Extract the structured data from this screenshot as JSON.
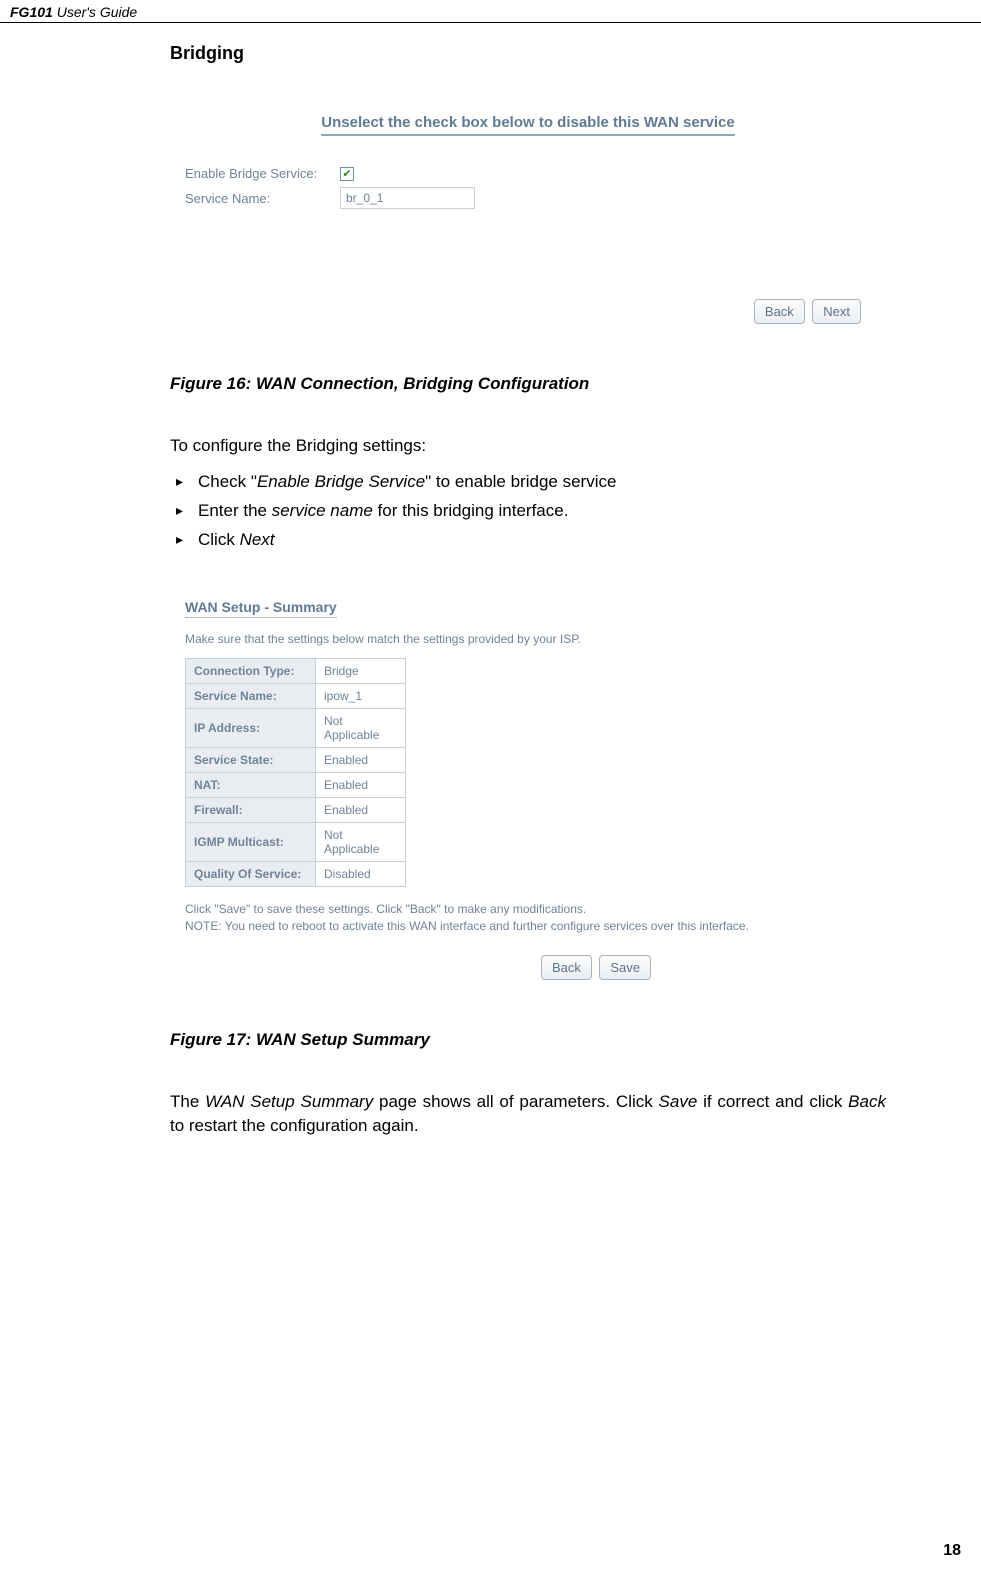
{
  "header": {
    "product": "FG101",
    "suffix": " User's Guide"
  },
  "section": {
    "heading": "Bridging"
  },
  "fig1": {
    "title": "Unselect the check box below to disable this WAN service",
    "enable_label": "Enable Bridge Service:",
    "enable_checked": "✔",
    "service_name_label": "Service Name:",
    "service_name_value": "br_0_1",
    "back_btn": "Back",
    "next_btn": "Next"
  },
  "caption1": "Figure 16: WAN Connection, Bridging Configuration",
  "intro": "To configure the Bridging settings:",
  "bullets": {
    "b1_pre": "Check \"",
    "b1_em": "Enable Bridge Service",
    "b1_post": "\" to enable bridge service",
    "b2_pre": "Enter the ",
    "b2_em": "service name",
    "b2_post": " for this bridging interface.",
    "b3_pre": "Click ",
    "b3_em": "Next"
  },
  "fig2": {
    "title": "WAN Setup - Summary",
    "desc": "Make sure that the settings below match the settings provided by your ISP.",
    "rows": [
      {
        "label": "Connection Type:",
        "val": "Bridge"
      },
      {
        "label": "Service Name:",
        "val": "ipow_1"
      },
      {
        "label": "IP Address:",
        "val": "Not Applicable"
      },
      {
        "label": "Service State:",
        "val": "Enabled"
      },
      {
        "label": "NAT:",
        "val": "Enabled"
      },
      {
        "label": "Firewall:",
        "val": "Enabled"
      },
      {
        "label": "IGMP Multicast:",
        "val": "Not Applicable"
      },
      {
        "label": "Quality Of Service:",
        "val": "Disabled"
      }
    ],
    "note1": "Click \"Save\" to save these settings. Click \"Back\" to make any modifications.",
    "note2": "NOTE: You need to reboot to activate this WAN interface and further configure services over this interface.",
    "back_btn": "Back",
    "save_btn": "Save"
  },
  "caption2": "Figure 17: WAN Setup Summary",
  "closing": {
    "p1a": "The ",
    "p1b": "WAN Setup Summary",
    "p1c": " page shows all of parameters. Click ",
    "p1d": "Save",
    "p1e": " if correct and click ",
    "p1f": "Back",
    "p1g": " to restart the configuration again."
  },
  "page_num": "18"
}
